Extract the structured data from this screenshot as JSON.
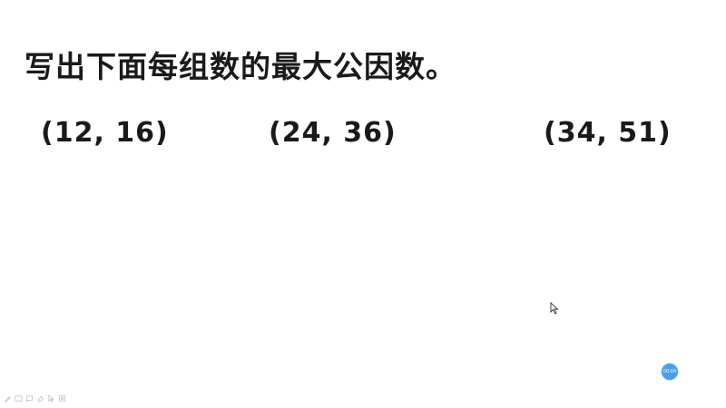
{
  "slide": {
    "title": "写出下面每组数的最大公因数。",
    "pairs": [
      "(12, 16)",
      "(24, 36)",
      "(34, 51)"
    ]
  },
  "player": {
    "timer": "00:04"
  },
  "toolbar": {
    "icons": [
      "pen-icon",
      "slides-icon",
      "chat-icon",
      "eraser-icon",
      "pointer-icon",
      "screenshot-icon"
    ]
  }
}
